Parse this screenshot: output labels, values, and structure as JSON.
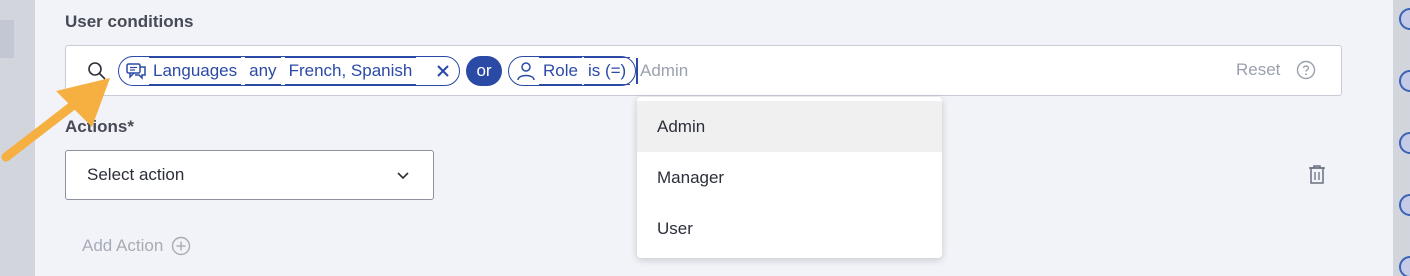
{
  "conditions": {
    "title": "User conditions",
    "chip_languages": {
      "label": "Languages",
      "operator": "any",
      "value": "French, Spanish"
    },
    "or_label": "or",
    "chip_role": {
      "label": "Role",
      "operator": "is (=)"
    },
    "value_placeholder": "Admin",
    "reset_label": "Reset"
  },
  "dropdown": {
    "options": [
      "Admin",
      "Manager",
      "User"
    ],
    "highlighted": "Admin"
  },
  "actions": {
    "title": "Actions*",
    "select_placeholder": "Select action",
    "add_action_label": "Add Action"
  },
  "colors": {
    "accent": "#2b4aa6",
    "annotation_arrow": "#f5b041"
  },
  "icons": {
    "search": "search-icon",
    "languages": "chat-bubbles-icon",
    "role": "person-icon",
    "close": "close-icon",
    "help": "help-circle-icon",
    "chevron": "chevron-down-icon",
    "trash": "trash-icon",
    "add": "plus-circle-icon"
  }
}
